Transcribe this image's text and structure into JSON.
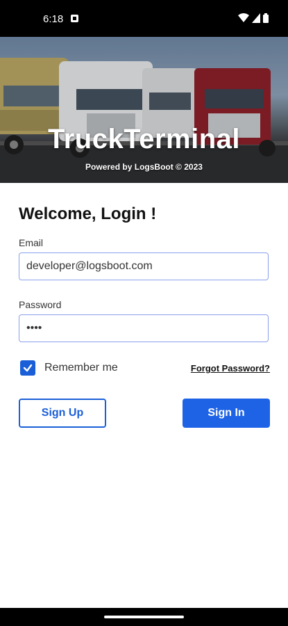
{
  "status_bar": {
    "time": "6:18"
  },
  "hero": {
    "title": "TruckTerminal",
    "subtitle": "Powered by LogsBoot © 2023"
  },
  "login": {
    "heading": "Welcome, Login !",
    "email_label": "Email",
    "email_value": "developer@logsboot.com",
    "password_label": "Password",
    "password_value": "••••",
    "remember_label": "Remember me",
    "remember_checked": true,
    "forgot_label": "Forgot Password?",
    "signup_label": "Sign Up",
    "signin_label": "Sign In"
  },
  "colors": {
    "primary": "#1e63e6",
    "field_border": "#8aa0ea"
  }
}
